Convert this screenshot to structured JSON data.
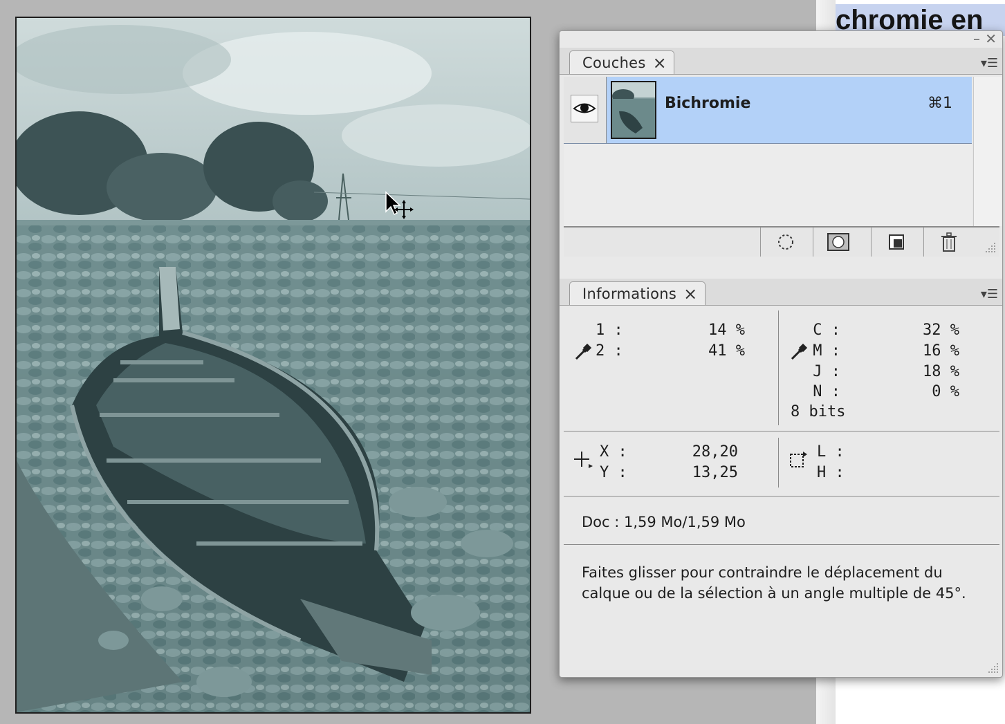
{
  "document": {
    "heading_fragment": "chromie en"
  },
  "couches_panel": {
    "tab_label": "Couches",
    "layer": {
      "name": "Bichromie",
      "shortcut": "⌘1"
    }
  },
  "info_panel": {
    "tab_label": "Informations",
    "channels_left": [
      {
        "label": "1 :",
        "value": "14 %"
      },
      {
        "label": "2 :",
        "value": "41 %"
      }
    ],
    "channels_right": [
      {
        "label": "C :",
        "value": "32 %"
      },
      {
        "label": "M :",
        "value": "16 %"
      },
      {
        "label": "J :",
        "value": "18 %"
      },
      {
        "label": "N :",
        "value": "0 %"
      }
    ],
    "bit_depth": "8 bits",
    "position": [
      {
        "label": "X :",
        "value": "28,20"
      },
      {
        "label": "Y :",
        "value": "13,25"
      }
    ],
    "size_labels": [
      "L :",
      "H :"
    ],
    "doc_status": "Doc : 1,59 Mo/1,59 Mo",
    "hint_text": "Faites glisser pour contraindre le déplacement du calque ou de la sélection à un angle multiple de 45°."
  },
  "icons": {
    "eye": "eye-icon",
    "eyedropper": "eyedropper-icon",
    "crosshair": "crosshair-icon",
    "marquee": "selection-size-icon",
    "move_cursor": "move-cursor-icon"
  },
  "colors": {
    "selection": "#b3d1f8",
    "panel": "#e9e9e9",
    "photo_tint": "#7f9a9b"
  }
}
